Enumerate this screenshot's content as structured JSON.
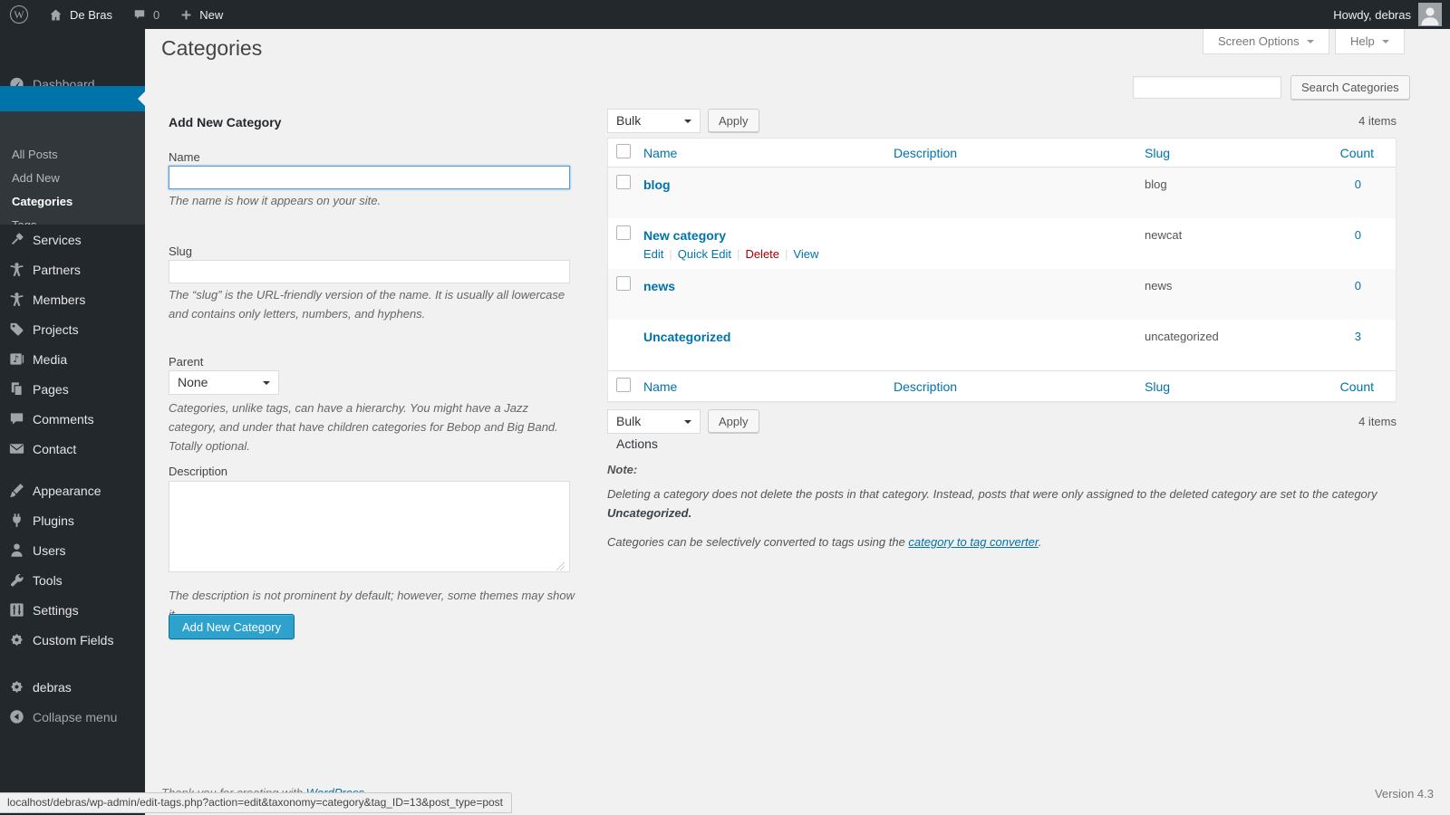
{
  "colors": {
    "link_blue": "#0073aa",
    "primary_button": "#2ea2cc",
    "delete_red": "#a00",
    "sidebar_bg": "#23282d",
    "active_highlight": "#0073aa"
  },
  "admin_bar": {
    "site_name": "De Bras",
    "comment_count": "0",
    "new_label": "New",
    "howdy": "Howdy, debras"
  },
  "sidebar": {
    "dashboard": "Dashboard",
    "submenu": [
      "All Posts",
      "Add New",
      "Categories",
      "Tags"
    ],
    "items": [
      "Services",
      "Partners",
      "Members",
      "Projects",
      "Media",
      "Pages",
      "Comments",
      "Contact",
      "Appearance",
      "Plugins",
      "Users",
      "Tools",
      "Settings",
      "Custom Fields",
      "debras",
      "Collapse menu"
    ]
  },
  "page": {
    "title": "Categories",
    "screen_options": "Screen Options",
    "help": "Help",
    "search_button": "Search Categories",
    "version": "Version 4.3",
    "thanks_prefix": "Thank you for creating with ",
    "thanks_link": "WordPress",
    "thanks_suffix": ".",
    "status_url": "localhost/debras/wp-admin/edit-tags.php?action=edit&taxonomy=category&tag_ID=13&post_type=post"
  },
  "form": {
    "heading": "Add New Category",
    "name_label": "Name",
    "name_help": "The name is how it appears on your site.",
    "slug_label": "Slug",
    "slug_help": "The “slug” is the URL-friendly version of the name. It is usually all lowercase and contains only letters, numbers, and hyphens.",
    "parent_label": "Parent",
    "parent_value": "None",
    "parent_help": "Categories, unlike tags, can have a hierarchy. You might have a Jazz category, and under that have children categories for Bebop and Big Band. Totally optional.",
    "description_label": "Description",
    "description_help": "The description is not prominent by default; however, some themes may show it.",
    "submit_label": "Add New Category"
  },
  "table": {
    "bulk_actions": "Bulk Actions",
    "apply": "Apply",
    "items_count": "4 items",
    "columns": [
      "Name",
      "Description",
      "Slug",
      "Count"
    ],
    "rows": [
      {
        "name": "blog",
        "description": "",
        "slug": "blog",
        "count": "0"
      },
      {
        "name": "New category",
        "description": "",
        "slug": "newcat",
        "count": "0",
        "actions": {
          "edit": "Edit",
          "quick_edit": "Quick Edit",
          "delete": "Delete",
          "view": "View"
        }
      },
      {
        "name": "news",
        "description": "",
        "slug": "news",
        "count": "0"
      },
      {
        "name": "Uncategorized",
        "description": "",
        "slug": "uncategorized",
        "count": "3"
      }
    ]
  },
  "note": {
    "label": "Note:",
    "line1": "Deleting a category does not delete the posts in that category. Instead, posts that were only assigned to the deleted category are set to the category ",
    "line1_bold": "Uncategorized.",
    "line2_prefix": "Categories can be selectively converted to tags using the ",
    "line2_link": "category to tag converter",
    "line2_suffix": "."
  }
}
